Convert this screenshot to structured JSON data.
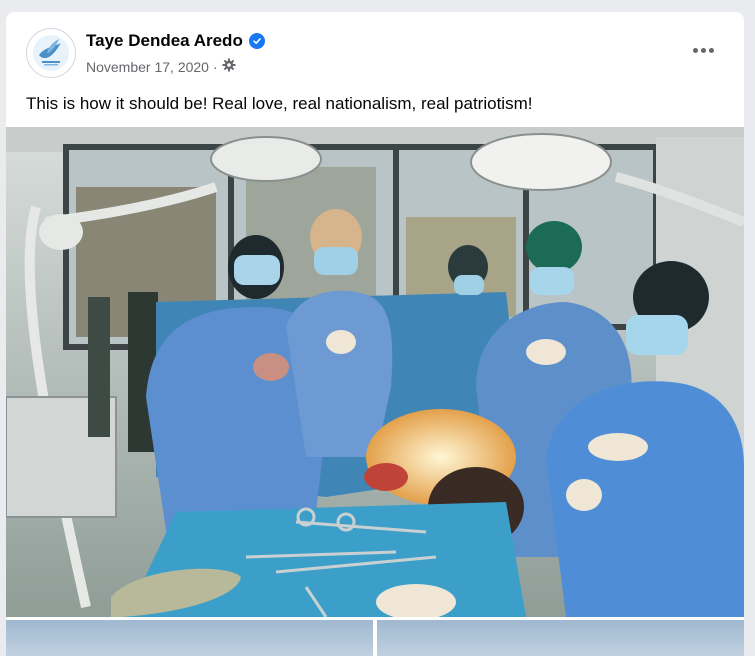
{
  "post": {
    "author": "Taye Dendea Aredo",
    "verified": true,
    "date": "November 17, 2020",
    "date_separator": "·",
    "audience_icon": "gear-icon",
    "more_icon": "more-options-icon",
    "text": "This is how it should be! Real love, real nationalism, real patriotism!"
  },
  "photo": {
    "scene_icon": "surgery-team-photo"
  },
  "colors": {
    "accent": "#1877f2",
    "secondary_text": "#65676b",
    "primary_text": "#050505",
    "background": "#e9ebee"
  }
}
